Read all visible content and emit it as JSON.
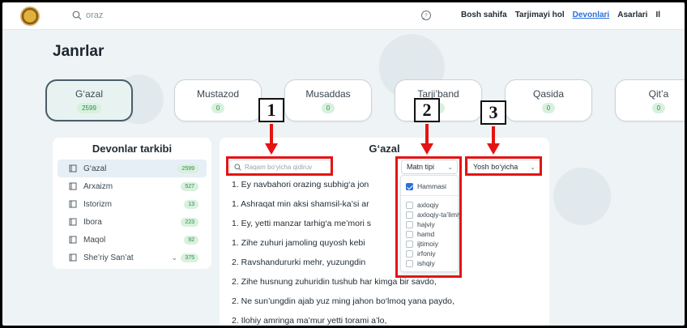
{
  "header": {
    "search_value": "oraz",
    "nav": [
      "Bosh sahifa",
      "Tarjimayi hol",
      "Devonlari",
      "Asarlari",
      "Il"
    ],
    "active_nav": "Devonlari"
  },
  "page_title": "Janrlar",
  "genres": [
    {
      "name": "G‘azal",
      "count": "2599"
    },
    {
      "name": "Mustazod",
      "count": "0"
    },
    {
      "name": "Musaddas",
      "count": "0"
    },
    {
      "name": "Tarji’band",
      "count": "0"
    },
    {
      "name": "Qasida",
      "count": "0"
    },
    {
      "name": "Qit’a",
      "count": "0"
    }
  ],
  "sidebar": {
    "title": "Devonlar tarkibi",
    "items": [
      {
        "label": "G‘azal",
        "count": "2599"
      },
      {
        "label": "Arxaizm",
        "count": "527"
      },
      {
        "label": "Istorizm",
        "count": "13"
      },
      {
        "label": "Ibora",
        "count": "223"
      },
      {
        "label": "Maqol",
        "count": "92"
      },
      {
        "label": "She’riy San’at",
        "count": "375"
      }
    ]
  },
  "main": {
    "title": "G‘azal",
    "number_search_placeholder": "Raqam bo‘yicha qidiruv",
    "text_type_label": "Matn tipi",
    "age_label": "Yosh bo‘yicha",
    "lines": [
      "1. Ey navbahori orazing subhig‘a jon",
      "1. Ashraqat min aksi shamsil-ka’si ar",
      "1. Ey, yetti manzar tarhig‘a me’mori s",
      "1. Zihe zuhuri jamoling quyosh kebi",
      "2. Ravshandururki mehr, yuzungdin",
      "2. Zihe husnung zuhuridin tushub har kimga bir savdo,",
      "2. Ne sun’ungdin ajab yuz ming jahon bo‘lmoq yana paydo,",
      "2. Ilohiy amringa ma’mur yetti torami a’lo,"
    ]
  },
  "dropdown": {
    "items": [
      "Hammasi",
      "axloqiy",
      "axloqiy-ta’limiy",
      "hajviy",
      "hamd",
      "ijtimoiy",
      "irfoniy",
      "ishqiy"
    ],
    "checked": "Hammasi"
  },
  "annotations": {
    "labels": [
      "1",
      "2",
      "3"
    ],
    "color": "#e41414"
  }
}
